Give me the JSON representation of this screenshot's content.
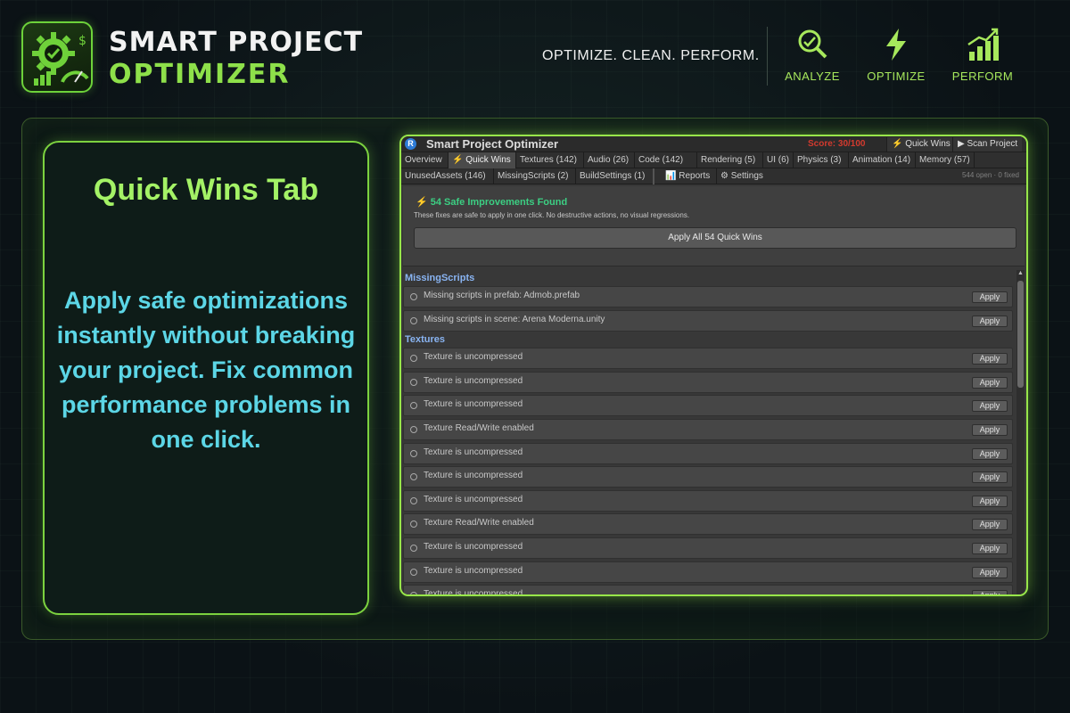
{
  "brand": {
    "line1": "SMART PROJECT",
    "line2": "OPTIMIZER",
    "tagline": "OPTIMIZE. CLEAN. PERFORM."
  },
  "features": [
    {
      "label": "ANALYZE",
      "icon": "magnifier-icon"
    },
    {
      "label": "OPTIMIZE",
      "icon": "lightning-icon"
    },
    {
      "label": "PERFORM",
      "icon": "bar-chart-icon"
    }
  ],
  "promo": {
    "title": "Quick Wins Tab",
    "description": "Apply safe optimizations instantly without breaking your project. Fix common performance problems in one click."
  },
  "window": {
    "title": "Smart Project Optimizer",
    "score": "Score: 30/100",
    "quick_wins_btn": "⚡ Quick Wins",
    "scan_btn": "▶ Scan Project",
    "tabs_row1": [
      "Overview",
      "⚡ Quick Wins",
      "Textures (142)",
      "Audio (26)",
      "Code (142)",
      "Rendering (5)",
      "UI (6)",
      "Physics (3)",
      "Animation (14)",
      "Memory (57)"
    ],
    "tabs_row2": [
      "UnusedAssets (146)",
      "MissingScripts (2)",
      "BuildSettings (1)",
      "📊 Reports",
      "⚙ Settings"
    ],
    "open_fixed": "544 open · 0 fixed",
    "banner": {
      "title": "⚡ 54 Safe Improvements Found",
      "subtitle": "These fixes are safe to apply in one click. No destructive actions, no visual regressions.",
      "apply_all": "Apply All 54 Quick Wins"
    },
    "apply_label": "Apply",
    "sections": [
      {
        "name": "MissingScripts",
        "items": [
          "Missing scripts in prefab: Admob.prefab",
          "Missing scripts in scene: Arena Moderna.unity"
        ]
      },
      {
        "name": "Textures",
        "items": [
          "Texture is uncompressed",
          "Texture is uncompressed",
          "Texture is uncompressed",
          "Texture Read/Write enabled",
          "Texture is uncompressed",
          "Texture is uncompressed",
          "Texture is uncompressed",
          "Texture Read/Write enabled",
          "Texture is uncompressed",
          "Texture is uncompressed",
          "Texture is uncompressed"
        ]
      }
    ]
  },
  "colors": {
    "accent_green": "#8ee04a",
    "accent_cyan": "#5cd6e6",
    "score_red": "#d33a2e",
    "section_blue": "#89b4f2",
    "banner_green": "#3ccf83"
  }
}
